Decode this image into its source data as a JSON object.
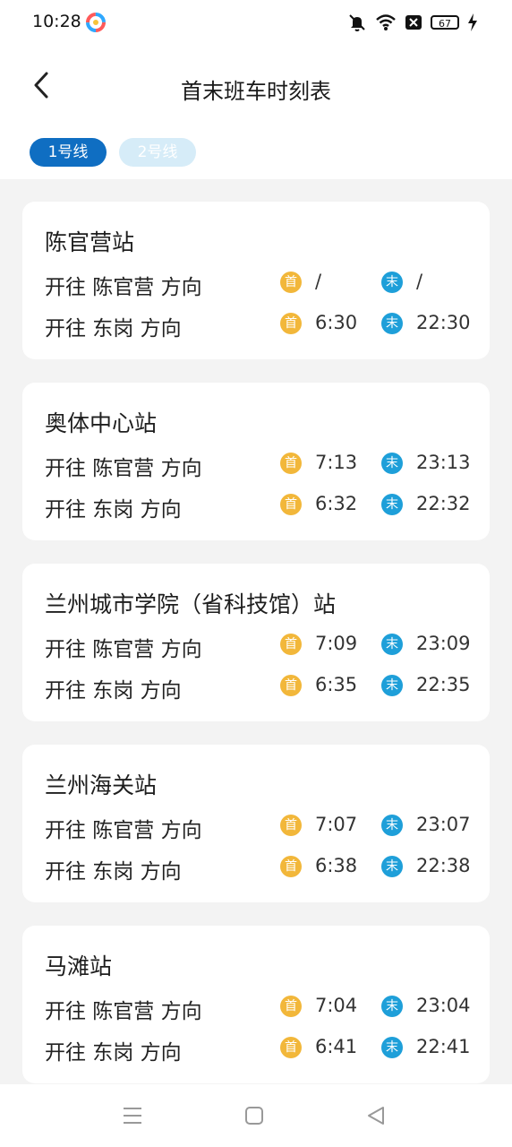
{
  "status": {
    "time": "10:28",
    "battery": "67"
  },
  "header": {
    "title": "首末班车时刻表"
  },
  "tabs": [
    {
      "label": "1号线"
    },
    {
      "label": "2号线"
    }
  ],
  "legend": {
    "first": "首",
    "last": "末"
  },
  "stations": [
    {
      "name": "陈官营站",
      "rows": [
        {
          "direction": "开往 陈官营 方向",
          "first": "/",
          "last": "/"
        },
        {
          "direction": "开往 东岗 方向",
          "first": "6:30",
          "last": "22:30"
        }
      ]
    },
    {
      "name": "奥体中心站",
      "rows": [
        {
          "direction": "开往 陈官营 方向",
          "first": "7:13",
          "last": "23:13"
        },
        {
          "direction": "开往 东岗 方向",
          "first": "6:32",
          "last": "22:32"
        }
      ]
    },
    {
      "name": "兰州城市学院（省科技馆）站",
      "rows": [
        {
          "direction": "开往 陈官营 方向",
          "first": "7:09",
          "last": "23:09"
        },
        {
          "direction": "开往 东岗 方向",
          "first": "6:35",
          "last": "22:35"
        }
      ]
    },
    {
      "name": "兰州海关站",
      "rows": [
        {
          "direction": "开往 陈官营 方向",
          "first": "7:07",
          "last": "23:07"
        },
        {
          "direction": "开往 东岗 方向",
          "first": "6:38",
          "last": "22:38"
        }
      ]
    },
    {
      "name": "马滩站",
      "rows": [
        {
          "direction": "开往 陈官营 方向",
          "first": "7:04",
          "last": "23:04"
        },
        {
          "direction": "开往 东岗 方向",
          "first": "6:41",
          "last": "22:41"
        }
      ]
    }
  ],
  "colors": {
    "accent": "#0f6ec2",
    "first_badge": "#f2b73a",
    "last_badge": "#1e9fd9",
    "background": "#f3f3f3"
  }
}
